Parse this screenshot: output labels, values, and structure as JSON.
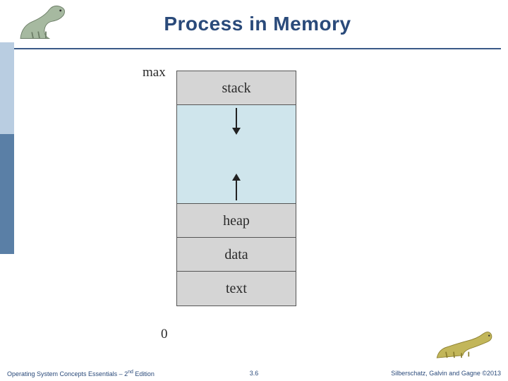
{
  "header": {
    "title": "Process in Memory"
  },
  "diagram": {
    "axis_top": "max",
    "axis_bottom": "0",
    "segments": {
      "stack": "stack",
      "heap": "heap",
      "data": "data",
      "text": "text"
    }
  },
  "footer": {
    "left_prefix": "Operating System Concepts Essentials – 2",
    "left_sup": "nd",
    "left_suffix": " Edition",
    "center": "3.6",
    "right": "Silberschatz, Galvin and Gagne ©2013"
  },
  "icons": {
    "dino_tl": "dinosaur-logo",
    "dino_br": "dinosaur-logo"
  }
}
